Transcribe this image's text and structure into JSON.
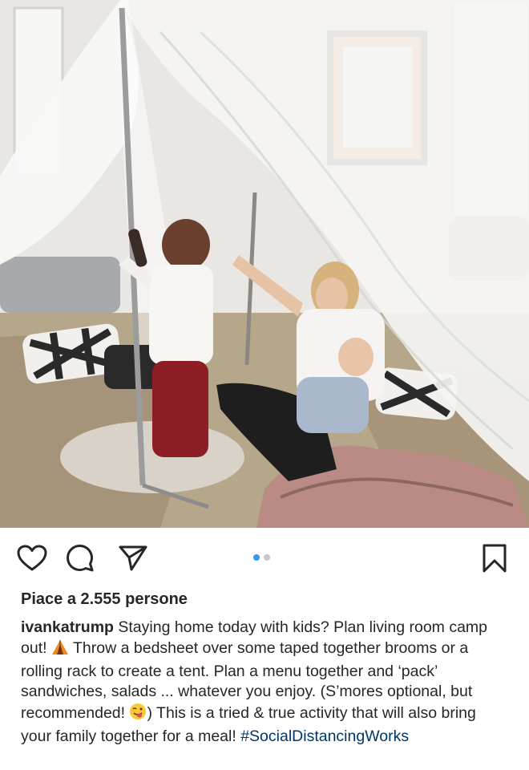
{
  "post": {
    "image": {
      "description_icon": "tent-photo"
    },
    "actions": {
      "like_icon": "heart-icon",
      "comment_icon": "comment-icon",
      "share_icon": "send-icon",
      "save_icon": "bookmark-icon"
    },
    "carousel": {
      "total": 2,
      "active": 1
    },
    "likes_text": "Piace a 2.555 persone",
    "caption": {
      "username": "ivankatrump",
      "text_part1": " Staying home today with kids? Plan living room camp out! ",
      "tent_emoji": "tent-emoji",
      "text_part2": " Throw a bedsheet over some taped together brooms or a rolling rack to create a tent. Plan a menu together and ‘pack’ sandwiches, salads ... whatever you enjoy. (S’mores optional, but recommended! ",
      "wink_emoji": "winking-tongue-emoji",
      "text_part3": ") This is a tried & true activity that will also bring your family together for a meal! ",
      "hashtag": "#SocialDistancingWorks"
    },
    "colors": {
      "accent": "#3897f0",
      "text": "#262626",
      "hashtag": "#003569"
    }
  }
}
